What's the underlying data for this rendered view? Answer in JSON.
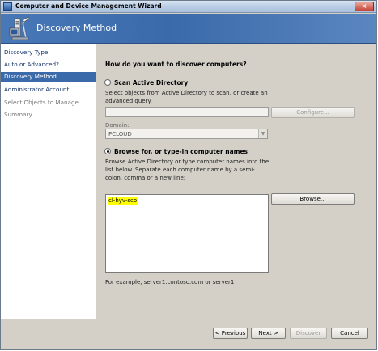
{
  "window": {
    "title": "Computer and Device Management Wizard",
    "close_glyph": "×"
  },
  "header": {
    "title": "Discovery Method",
    "icon": "wizard-computer-icon"
  },
  "nav": {
    "items": [
      {
        "label": "Discovery Type",
        "state": "normal"
      },
      {
        "label": "Auto or Advanced?",
        "state": "normal"
      },
      {
        "label": "Discovery Method",
        "state": "active"
      },
      {
        "label": "Administrator Account",
        "state": "normal"
      },
      {
        "label": "Select Objects to Manage",
        "state": "disabled"
      },
      {
        "label": "Summary",
        "state": "disabled"
      }
    ]
  },
  "main": {
    "question": "How do you want to discover computers?",
    "scan_ad": {
      "label": "Scan Active Directory",
      "selected": false,
      "description": "Select objects from Active Directory to scan, or create an advanced query.",
      "query_value": "",
      "configure_label": "Configure...",
      "domain_label": "Domain:",
      "domain_value": "PCLOUD"
    },
    "browse": {
      "label": "Browse for, or type-in computer names",
      "selected": true,
      "description": "Browse Active Directory or type computer names into the list below. Separate each computer name by a semi-colon, comma or a new line:",
      "names_value": "cl-hyv-sco",
      "browse_label": "Browse...",
      "example": "For example, server1.contoso.com or server1"
    }
  },
  "footer": {
    "previous_label": "< Previous",
    "next_label": "Next >",
    "discover_label": "Discover",
    "cancel_label": "Cancel"
  },
  "colors": {
    "nav_active": "#3a6aaa",
    "header_blue": "#4878b7",
    "dialog_bg": "#d4d0c8",
    "highlight": "#ffff00"
  }
}
